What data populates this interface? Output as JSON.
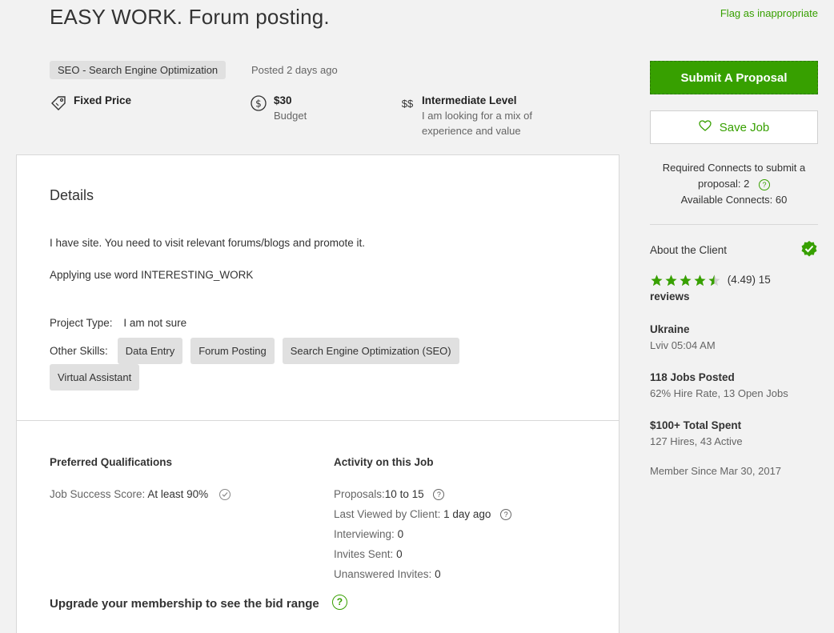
{
  "job": {
    "title": "EASY WORK. Forum posting.",
    "flag_label": "Flag as inappropriate",
    "category": "SEO - Search Engine Optimization",
    "posted": "Posted 2 days ago",
    "price_type": "Fixed Price",
    "budget_value": "$30",
    "budget_label": "Budget",
    "level_icon": "$$",
    "level_title": "Intermediate Level",
    "level_desc_line1": "I am looking for a mix of",
    "level_desc_line2": "experience and value"
  },
  "details": {
    "heading": "Details",
    "desc1": "I have site. You need to visit relevant forums/blogs and promote it.",
    "desc2": "Applying use word INTERESTING_WORK",
    "project_type_label": "Project Type:",
    "project_type_value": "I am not sure",
    "other_skills_label": "Other Skills:",
    "skills": [
      "Data Entry",
      "Forum Posting",
      "Search Engine Optimization (SEO)",
      "Virtual Assistant"
    ]
  },
  "qualifications": {
    "heading": "Preferred Qualifications",
    "jss_label": "Job Success Score:",
    "jss_value": "At least 90%"
  },
  "activity": {
    "heading": "Activity on this Job",
    "proposals_label": "Proposals:",
    "proposals_value": "10 to 15",
    "last_viewed_label": "Last Viewed by Client:",
    "last_viewed_value": "1 day ago",
    "interviewing_label": "Interviewing:",
    "interviewing_value": "0",
    "invites_label": "Invites Sent:",
    "invites_value": "0",
    "unanswered_label": "Unanswered Invites:",
    "unanswered_value": "0"
  },
  "upgrade": {
    "text": "Upgrade your membership to see the bid range"
  },
  "sidebar": {
    "submit_label": "Submit A Proposal",
    "save_label": "Save Job",
    "connects_line1": "Required Connects to submit a",
    "connects_line2": "proposal: 2",
    "connects_line3": "Available Connects: 60",
    "about_client": "About the Client",
    "rating": 4.49,
    "rating_text": "(4.49) 15",
    "reviews_text": "reviews",
    "country": "Ukraine",
    "location_time": "Lviv 05:04 AM",
    "jobs_posted": "118 Jobs Posted",
    "hire_rate": "62% Hire Rate, 13 Open Jobs",
    "total_spent": "$100+ Total Spent",
    "hires": "127 Hires, 43 Active",
    "member_since": "Member Since Mar 30, 2017"
  },
  "colors": {
    "brand": "#37a000",
    "tag_bg": "#e0e0e0"
  }
}
